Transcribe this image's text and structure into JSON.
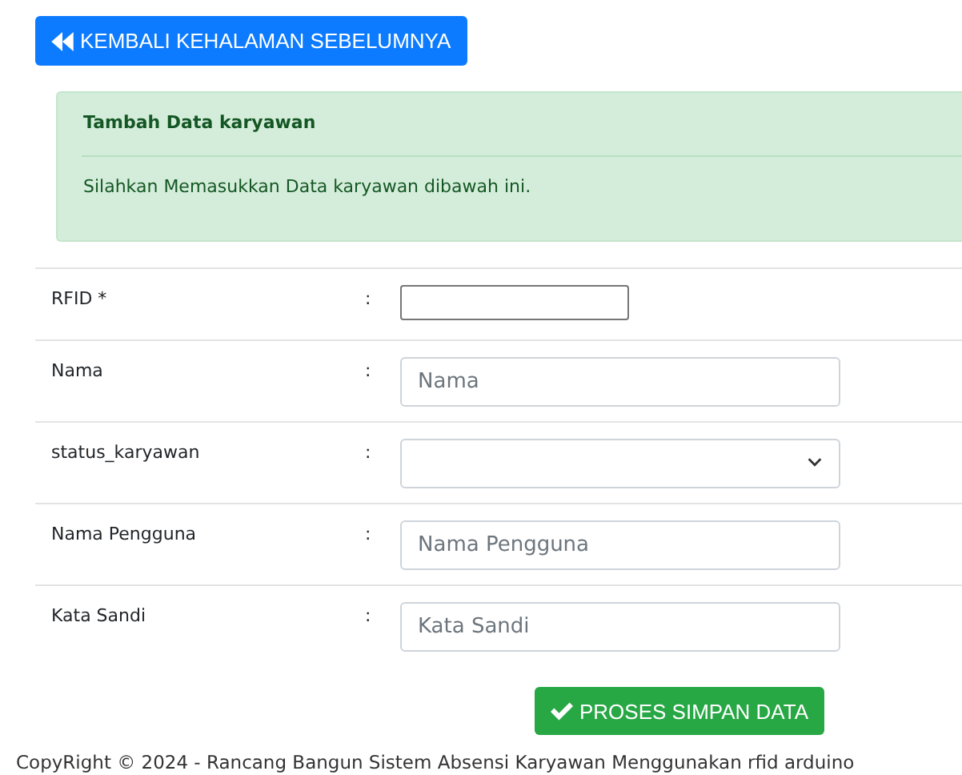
{
  "back_button": {
    "label": "KEMBALI KEHALAMAN SEBELUMNYA"
  },
  "alert": {
    "title": "Tambah Data karyawan",
    "message": "Silahkan Memasukkan Data karyawan dibawah ini."
  },
  "fields": [
    {
      "label": "RFID *",
      "separator": ":",
      "kind": "plain"
    },
    {
      "label": "Nama",
      "separator": ":",
      "kind": "text",
      "placeholder": "Nama"
    },
    {
      "label": "status_karyawan",
      "separator": ":",
      "kind": "select"
    },
    {
      "label": "Nama Pengguna",
      "separator": ":",
      "kind": "text",
      "placeholder": "Nama Pengguna"
    },
    {
      "label": "Kata Sandi",
      "separator": ":",
      "kind": "password",
      "placeholder": "Kata Sandi"
    }
  ],
  "submit_button": {
    "label": "PROSES SIMPAN DATA"
  },
  "footer": "CopyRight © 2024 - Rancang Bangun Sistem Absensi Karyawan Menggunakan rfid arduino"
}
